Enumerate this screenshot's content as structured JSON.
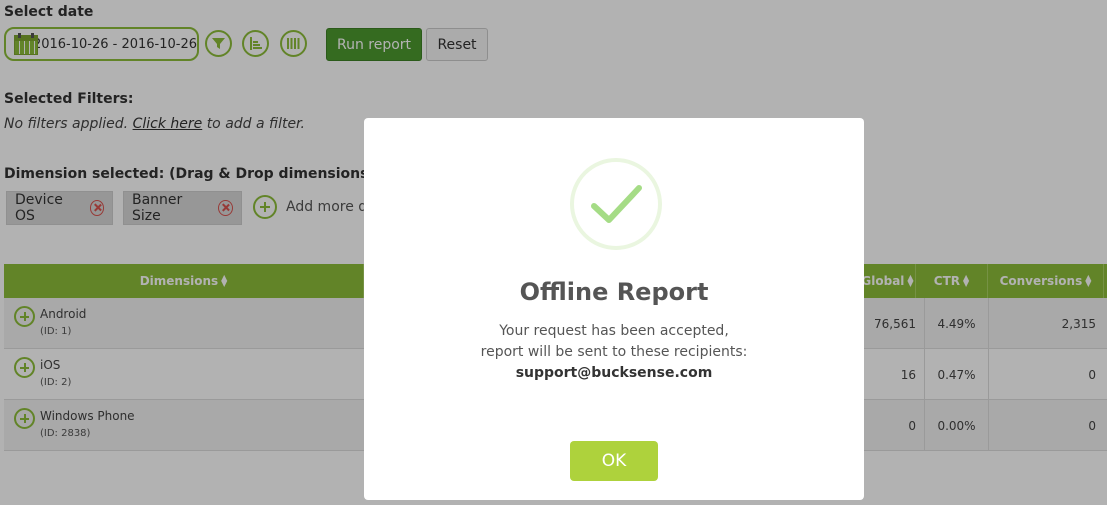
{
  "date_section": {
    "label": "Select date",
    "date_range": "2016-10-26 - 2016-10-26"
  },
  "toolbar": {
    "filter_icon": "filter-icon",
    "list_icon": "list-icon",
    "columns_icon": "columns-icon",
    "run_label": "Run report",
    "reset_label": "Reset"
  },
  "filters": {
    "label": "Selected Filters:",
    "prefix": "No filters applied.",
    "link": "Click here",
    "suffix": "to add a filter."
  },
  "dimensions": {
    "label": "Dimension selected: (Drag & Drop dimensions to re-",
    "chips": [
      {
        "label": "Device OS"
      },
      {
        "label": "Banner Size"
      }
    ],
    "add_more": "Add more d"
  },
  "table": {
    "headers": {
      "dimensions": "Dimensions",
      "global": "Global",
      "ctr": "CTR",
      "conversions": "Conversions"
    },
    "rows": [
      {
        "name": "Android",
        "id": "(ID: 1)",
        "global": "76,561",
        "ctr": "4.49%",
        "conversions": "2,315"
      },
      {
        "name": "iOS",
        "id": "(ID: 2)",
        "global": "16",
        "ctr": "0.47%",
        "conversions": "0"
      },
      {
        "name": "Windows Phone",
        "id": "(ID: 2838)",
        "global": "0",
        "ctr": "0.00%",
        "conversions": "0"
      }
    ]
  },
  "modal": {
    "title": "Offline Report",
    "line1": "Your request has been accepted,",
    "line2": "report will be sent to these recipients:",
    "email": "support@bucksense.com",
    "ok_label": "OK"
  },
  "colors": {
    "accent": "#8dbe3a",
    "run_button": "#4d9a2f",
    "ok_button": "#aed23c",
    "check": "#a5dc86"
  }
}
